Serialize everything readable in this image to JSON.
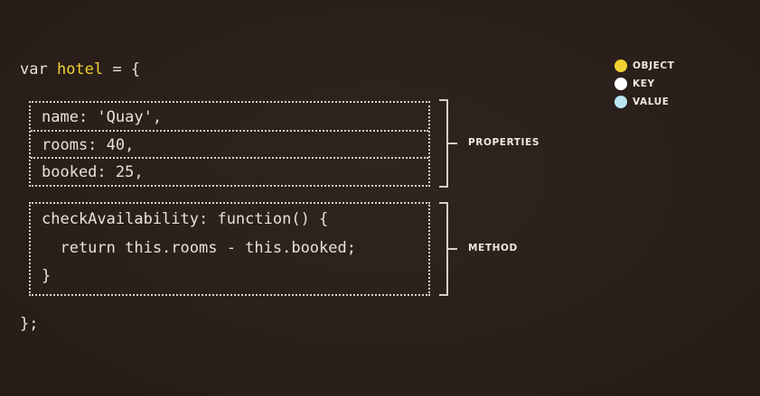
{
  "code": {
    "open_prefix": "var ",
    "object_name": "hotel",
    "open_suffix": " = {",
    "properties": [
      "name: 'Quay',",
      "rooms: 40,",
      "booked: 25,"
    ],
    "method": [
      "checkAvailability: function() {",
      "  return this.rooms - this.booked;",
      "}"
    ],
    "close": "};"
  },
  "callouts": {
    "properties": "PROPERTIES",
    "method": "METHOD"
  },
  "legend": [
    {
      "label": "OBJECT",
      "color": "#f2d233"
    },
    {
      "label": "KEY",
      "color": "#ffffff"
    },
    {
      "label": "VALUE",
      "color": "#b9e6f0"
    }
  ]
}
